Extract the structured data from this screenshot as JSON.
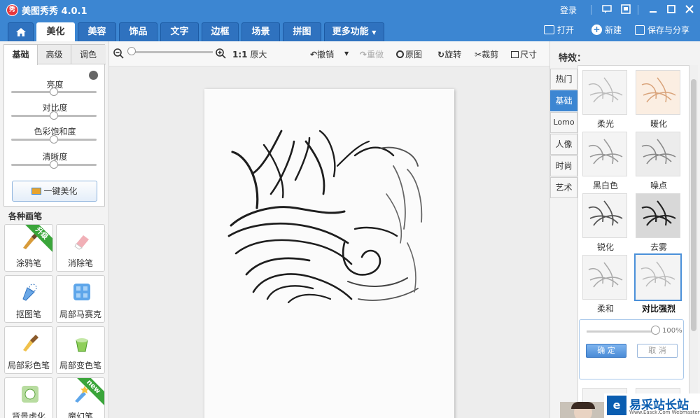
{
  "app": {
    "title": "美图秀秀 4.0.1",
    "logo_text": "秀"
  },
  "titlebar": {
    "login": "登录",
    "icons": [
      "chat-icon",
      "skin-icon",
      "minimize-icon",
      "maximize-icon",
      "close-icon"
    ]
  },
  "nav": {
    "tabs": [
      {
        "label": "美化"
      },
      {
        "label": "美容"
      },
      {
        "label": "饰品"
      },
      {
        "label": "文字"
      },
      {
        "label": "边框"
      },
      {
        "label": "场景"
      },
      {
        "label": "拼图"
      },
      {
        "label": "更多功能"
      }
    ],
    "open": "打开",
    "new": "新建",
    "save": "保存与分享"
  },
  "adjust": {
    "tabs": [
      "基础",
      "高级",
      "调色"
    ],
    "sliders": [
      {
        "label": "亮度",
        "level": 0.5
      },
      {
        "label": "对比度",
        "level": 0.5
      },
      {
        "label": "色彩饱和度",
        "level": 0.5
      },
      {
        "label": "清晰度",
        "level": 0.5
      }
    ],
    "one_click": "一键美化"
  },
  "brushes": {
    "title": "各种画笔",
    "items": [
      {
        "label": "涂鸦笔",
        "badge": "升级"
      },
      {
        "label": "消除笔",
        "badge": ""
      },
      {
        "label": "抠图笔",
        "badge": ""
      },
      {
        "label": "局部马赛克",
        "badge": ""
      },
      {
        "label": "局部彩色笔",
        "badge": ""
      },
      {
        "label": "局部变色笔",
        "badge": ""
      },
      {
        "label": "背景虚化",
        "badge": ""
      },
      {
        "label": "魔幻笔",
        "badge": "new"
      }
    ]
  },
  "toolbar": {
    "zoom_level": 0.0,
    "original_size_prefix": "1:1",
    "original_size": "原大",
    "undo": "撤销",
    "redo": "重做",
    "original": "原图",
    "rotate": "旋转",
    "crop": "裁剪",
    "size": "尺寸"
  },
  "effects": {
    "title": "特效：",
    "categories": [
      "热门",
      "基础",
      "Lomo",
      "人像",
      "时尚",
      "艺术"
    ],
    "active_category": "基础",
    "items": [
      {
        "label": "柔光"
      },
      {
        "label": "暖化"
      },
      {
        "label": "黑白色"
      },
      {
        "label": "噪点"
      },
      {
        "label": "锐化"
      },
      {
        "label": "去雾"
      },
      {
        "label": "柔和"
      },
      {
        "label": "对比强烈"
      }
    ],
    "selected": "对比强烈",
    "popup": {
      "level": 1.0,
      "percent": "100%",
      "ok": "确 定",
      "cancel": "取 消"
    }
  },
  "watermark": {
    "logo": "e",
    "text": "易采站长站",
    "sub": "Www.Easck.Com Webmaster"
  },
  "colors": {
    "accent": "#3c86d2",
    "dark_tab": "#2f72bf",
    "badge_green": "#3aa53a"
  }
}
